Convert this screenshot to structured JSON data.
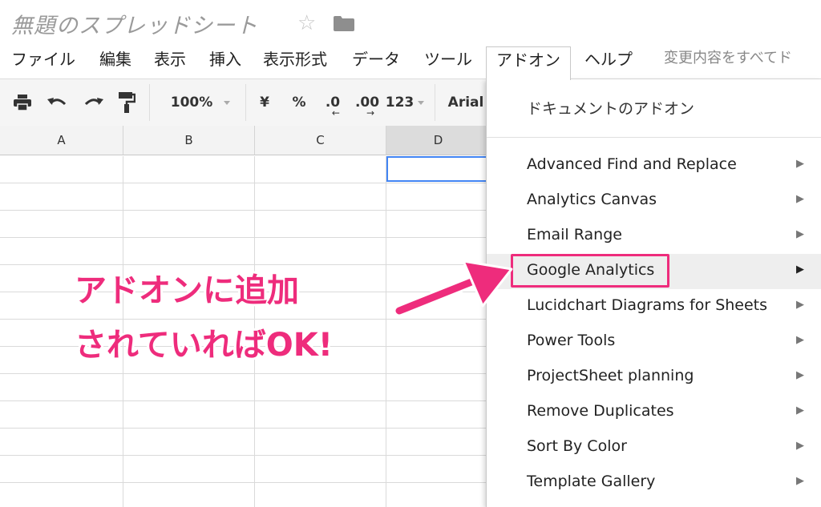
{
  "app": {
    "doc_title": "無題のスプレッドシート",
    "star_icon": "star-icon",
    "folder_icon": "folder-icon"
  },
  "menubar": {
    "items": [
      "ファイル",
      "編集",
      "表示",
      "挿入",
      "表示形式",
      "データ",
      "ツール",
      "アドオン",
      "ヘルプ"
    ],
    "active": "アドオン",
    "save_status": "変更内容をすべてド"
  },
  "toolbar": {
    "print_icon": "print-icon",
    "undo_icon": "undo-icon",
    "redo_icon": "redo-icon",
    "paint_format_icon": "paint-format-icon",
    "zoom": "100%",
    "currency": "¥",
    "percent": "%",
    "decrease_decimal": ".0",
    "increase_decimal": ".00",
    "more_formats": "123",
    "font": "Arial"
  },
  "grid": {
    "columns": [
      "A",
      "B",
      "C",
      "D"
    ],
    "selected_column": "D"
  },
  "addon_menu": {
    "header": "ドキュメントのアドオン",
    "items": [
      "Advanced Find and Replace",
      "Analytics Canvas",
      "Email Range",
      "Google Analytics",
      "Lucidchart Diagrams for Sheets",
      "Power Tools",
      "ProjectSheet planning",
      "Remove Duplicates",
      "Sort By Color",
      "Template Gallery"
    ],
    "highlighted": "Google Analytics",
    "submenu_arrow": "▶"
  },
  "annotation": {
    "line1": "アドオンに追加",
    "line2": "されていればOK!",
    "color": "#ee2c7c"
  }
}
